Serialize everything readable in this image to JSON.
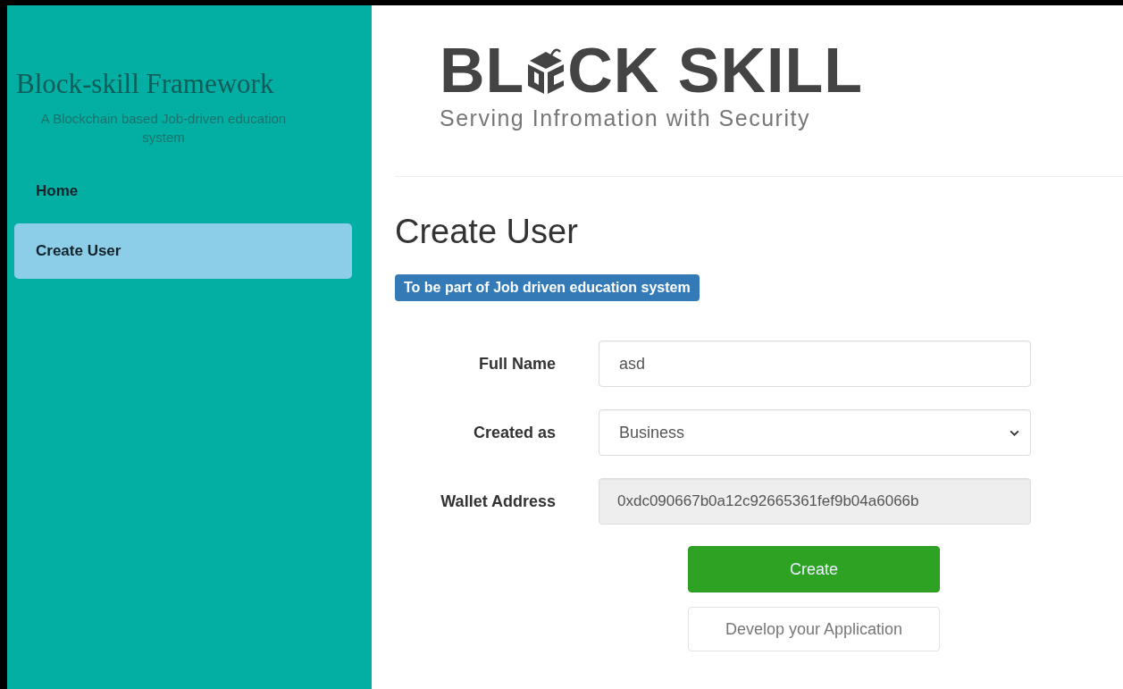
{
  "sidebar": {
    "title": "Block-skill Framework",
    "subtitle": "A Blockchain based Job-driven education system",
    "nav": [
      {
        "label": "Home",
        "selected": false
      },
      {
        "label": "Create User",
        "selected": true
      }
    ]
  },
  "logo": {
    "before": "BL",
    "after": "CK SKILL",
    "tagline": "Serving Infromation with Security"
  },
  "heading": "Create User",
  "badge": "To be part of Job driven education system",
  "fields": [
    {
      "label": "Full Name",
      "kind": "text",
      "value": "asd"
    },
    {
      "label": "Created as",
      "kind": "select",
      "value": "Business"
    },
    {
      "label": "Wallet Address",
      "kind": "readonly",
      "value": "0xdc090667b0a12c92665361fef9b04a6066b"
    }
  ],
  "buttons": [
    {
      "label": "Create",
      "kind": "primary"
    },
    {
      "label": "Develop your Application",
      "kind": "default"
    }
  ]
}
